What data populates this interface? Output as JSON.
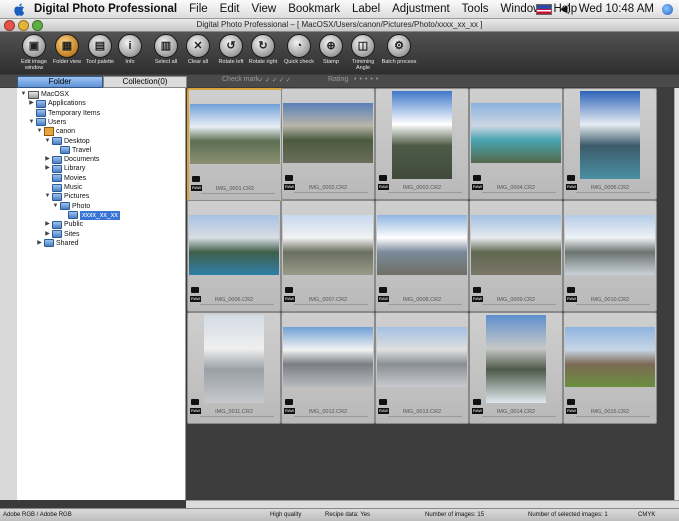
{
  "menubar": {
    "app_name": "Digital Photo Professional",
    "items": [
      "File",
      "Edit",
      "View",
      "Bookmark",
      "Label",
      "Adjustment",
      "Tools",
      "Window",
      "Help"
    ],
    "clock": "Wed 10:48 AM"
  },
  "window": {
    "title": "Digital Photo Professional – [ MacOSX/Users/canon/Pictures/Photo/xxxx_xx_xx ]"
  },
  "toolbar": {
    "buttons": [
      {
        "label": "Edit image window",
        "icon": "edit-window-icon"
      },
      {
        "label": "Folder view",
        "icon": "folder-view-icon"
      },
      {
        "label": "Tool palette",
        "icon": "tool-palette-icon"
      },
      {
        "label": "Info",
        "icon": "info-icon"
      },
      {
        "label": "Select all",
        "icon": "select-all-icon"
      },
      {
        "label": "Clear all",
        "icon": "clear-all-icon"
      },
      {
        "label": "Rotate left",
        "icon": "rotate-left-icon"
      },
      {
        "label": "Rotate right",
        "icon": "rotate-right-icon"
      },
      {
        "label": "Quick check",
        "icon": "quick-check-icon"
      },
      {
        "label": "Stamp",
        "icon": "stamp-icon"
      },
      {
        "label": "Trimming Angle",
        "icon": "trimming-icon"
      },
      {
        "label": "Batch process",
        "icon": "batch-process-icon"
      }
    ]
  },
  "tabs": {
    "folder": "Folder",
    "collection": "Collection(0)",
    "checkmark_label": "Check mark",
    "rating_label": "Rating"
  },
  "tree": [
    {
      "label": "MacOSX",
      "depth": 0,
      "disc": "▼",
      "icon": "hd"
    },
    {
      "label": "Applications",
      "depth": 1,
      "disc": "▶",
      "icon": "folder"
    },
    {
      "label": "Temporary Items",
      "depth": 1,
      "disc": "",
      "icon": "folder"
    },
    {
      "label": "Users",
      "depth": 1,
      "disc": "▼",
      "icon": "folder"
    },
    {
      "label": "canon",
      "depth": 2,
      "disc": "▼",
      "icon": "home"
    },
    {
      "label": "Desktop",
      "depth": 3,
      "disc": "▼",
      "icon": "folder"
    },
    {
      "label": "Travel",
      "depth": 4,
      "disc": "",
      "icon": "folder"
    },
    {
      "label": "Documents",
      "depth": 3,
      "disc": "▶",
      "icon": "folder"
    },
    {
      "label": "Library",
      "depth": 3,
      "disc": "▶",
      "icon": "folder"
    },
    {
      "label": "Movies",
      "depth": 3,
      "disc": "",
      "icon": "folder"
    },
    {
      "label": "Music",
      "depth": 3,
      "disc": "",
      "icon": "folder"
    },
    {
      "label": "Pictures",
      "depth": 3,
      "disc": "▼",
      "icon": "folder"
    },
    {
      "label": "Photo",
      "depth": 4,
      "disc": "▼",
      "icon": "folder"
    },
    {
      "label": "xxxx_xx_xx",
      "depth": 5,
      "disc": "",
      "icon": "folder",
      "selected": true
    },
    {
      "label": "Public",
      "depth": 3,
      "disc": "▶",
      "icon": "folder"
    },
    {
      "label": "Sites",
      "depth": 3,
      "disc": "▶",
      "icon": "folder"
    },
    {
      "label": "Shared",
      "depth": 2,
      "disc": "▶",
      "icon": "folder"
    }
  ],
  "thumbnails": [
    {
      "name": "IMG_0001.CR2",
      "orient": "landscape",
      "selected": true,
      "colors": [
        "#6fa0d8",
        "#e9eef5",
        "#5d6f52",
        "#8c8f73"
      ]
    },
    {
      "name": "IMG_0002.CR2",
      "orient": "landscape",
      "colors": [
        "#5a7fb8",
        "#b8b6aa",
        "#4b5a3e",
        "#6c6d5c"
      ]
    },
    {
      "name": "IMG_0003.CR2",
      "orient": "portrait",
      "colors": [
        "#3f78c9",
        "#ffffff",
        "#4e5b47",
        "#404a3a"
      ]
    },
    {
      "name": "IMG_0004.CR2",
      "orient": "landscape",
      "colors": [
        "#8ab1de",
        "#ccd7e3",
        "#47a3b0",
        "#55684a"
      ]
    },
    {
      "name": "IMG_0005.CR2",
      "orient": "portrait",
      "colors": [
        "#2d63b8",
        "#e6ecf2",
        "#3c5b6a",
        "#4a8fa3"
      ]
    },
    {
      "name": "IMG_0006.CR2",
      "orient": "landscape",
      "colors": [
        "#a7c3e3",
        "#d9dde4",
        "#3f5f4a",
        "#2f7fa8"
      ]
    },
    {
      "name": "IMG_0007.CR2",
      "orient": "landscape",
      "colors": [
        "#c7d9ee",
        "#f2f2f2",
        "#6b7060",
        "#9a9a8a"
      ]
    },
    {
      "name": "IMG_0008.CR2",
      "orient": "landscape",
      "colors": [
        "#8fb5e0",
        "#ffffff",
        "#7a8a9a",
        "#6f6f65"
      ]
    },
    {
      "name": "IMG_0009.CR2",
      "orient": "landscape",
      "colors": [
        "#9fbfe2",
        "#e8ebee",
        "#5f6850",
        "#7a7568"
      ]
    },
    {
      "name": "IMG_0010.CR2",
      "orient": "landscape",
      "colors": [
        "#b4cbe6",
        "#eef2f6",
        "#6d7470",
        "#c9d2d8"
      ]
    },
    {
      "name": "IMG_0011.CR2",
      "orient": "portrait",
      "colors": [
        "#d3dbe3",
        "#efefef",
        "#9aa0a5",
        "#c6c9cc"
      ]
    },
    {
      "name": "IMG_0012.CR2",
      "orient": "landscape",
      "colors": [
        "#6f9fd5",
        "#f2f2f2",
        "#7a7d82",
        "#b8bbbe"
      ]
    },
    {
      "name": "IMG_0013.CR2",
      "orient": "landscape",
      "colors": [
        "#a3c0e3",
        "#dfdfdf",
        "#8a8f95",
        "#c7cacd"
      ]
    },
    {
      "name": "IMG_0014.CR2",
      "orient": "portrait",
      "colors": [
        "#5e8fce",
        "#c8c8c8",
        "#4d5a49",
        "#e0e8ee"
      ]
    },
    {
      "name": "IMG_0015.CR2",
      "orient": "landscape",
      "colors": [
        "#8fb3df",
        "#c7d6e6",
        "#7c6a54",
        "#6a8f3e"
      ]
    }
  ],
  "status": {
    "color_space": "Adobe RGB / Adobe RGB",
    "quality": "High quality",
    "recipe": "Recipe data: Yes",
    "num_images": "Number of images: 15",
    "num_selected": "Number of selected images: 1",
    "cmyk": "CMYK"
  }
}
